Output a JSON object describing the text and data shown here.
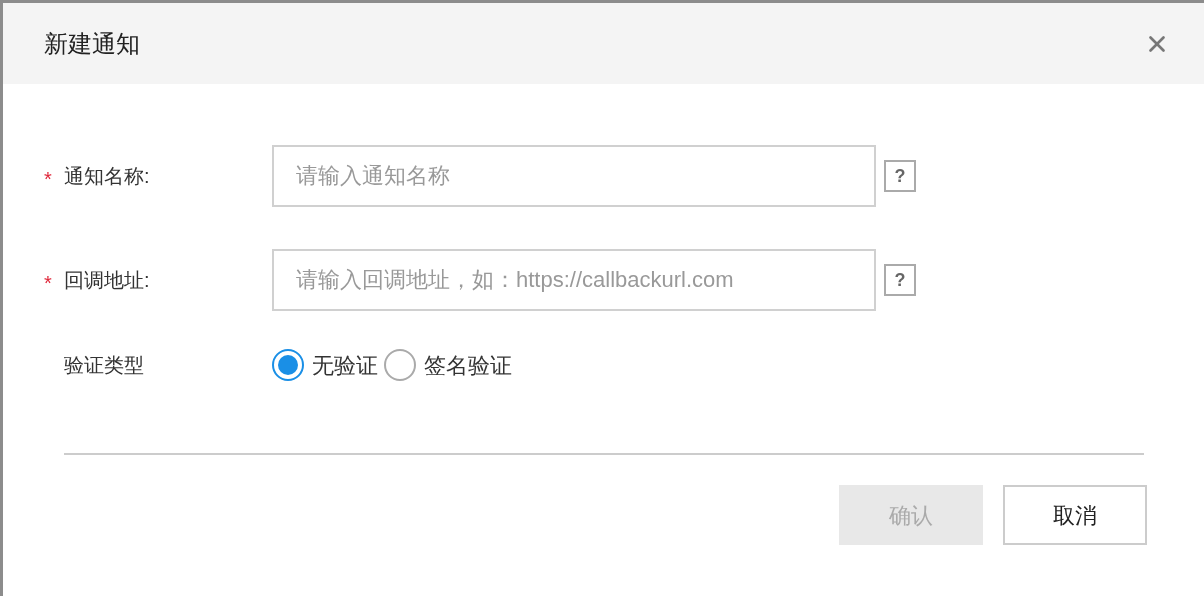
{
  "dialog": {
    "title": "新建通知"
  },
  "fields": [
    {
      "required_mark": "*",
      "label": "通知名称:",
      "placeholder": "请输入通知名称",
      "help": "?"
    },
    {
      "required_mark": "*",
      "label": "回调地址:",
      "placeholder": "请输入回调地址，如：https://callbackurl.com",
      "help": "?"
    }
  ],
  "verify": {
    "label": "验证类型",
    "options": [
      {
        "label": "无验证",
        "selected": true
      },
      {
        "label": "签名验证",
        "selected": false
      }
    ]
  },
  "buttons": [
    {
      "label": "确认",
      "disabled": true
    },
    {
      "label": "取消",
      "disabled": false
    }
  ]
}
